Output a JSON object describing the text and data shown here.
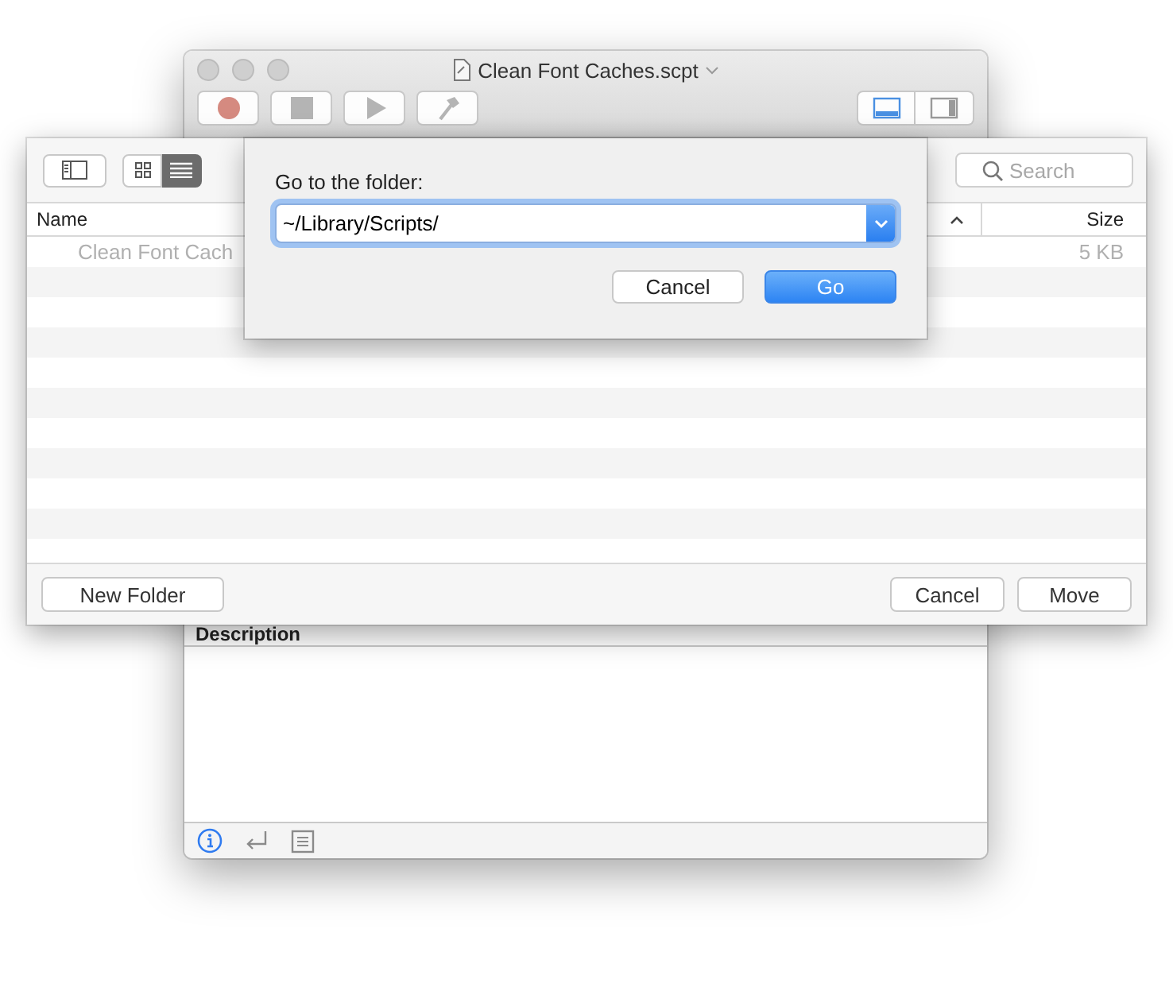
{
  "editor_window": {
    "title": "Clean Font Caches.scpt",
    "toolbar": [
      {
        "kind": "record"
      },
      {
        "kind": "stop"
      },
      {
        "kind": "run"
      },
      {
        "kind": "compile"
      }
    ],
    "pane_toggles": [
      {
        "kind": "bottom-pane",
        "selected": true
      },
      {
        "kind": "side-pane",
        "selected": false
      }
    ],
    "description_label": "Description",
    "bottom_tabs": [
      {
        "kind": "info",
        "selected": true
      },
      {
        "kind": "return",
        "selected": false
      },
      {
        "kind": "list",
        "selected": false
      }
    ]
  },
  "move_sheet": {
    "sidebar_shown": false,
    "view_modes": [
      {
        "kind": "icons",
        "selected": false
      },
      {
        "kind": "list",
        "selected": true
      }
    ],
    "search": {
      "placeholder": "Search"
    },
    "columns": [
      {
        "label": "Name"
      },
      {
        "label": "Size"
      }
    ],
    "sort_ascending": true,
    "rows": [
      {
        "name": "Clean Font Cach",
        "size": "5 KB",
        "disabled": true
      }
    ],
    "buttons": {
      "new_folder": "New Folder",
      "cancel": "Cancel",
      "confirm": "Move"
    }
  },
  "goto_dialog": {
    "prompt": "Go to the folder:",
    "path": "~/Library/Scripts/",
    "buttons": [
      {
        "label": "Cancel",
        "default": false
      },
      {
        "label": "Go",
        "default": true
      }
    ]
  }
}
